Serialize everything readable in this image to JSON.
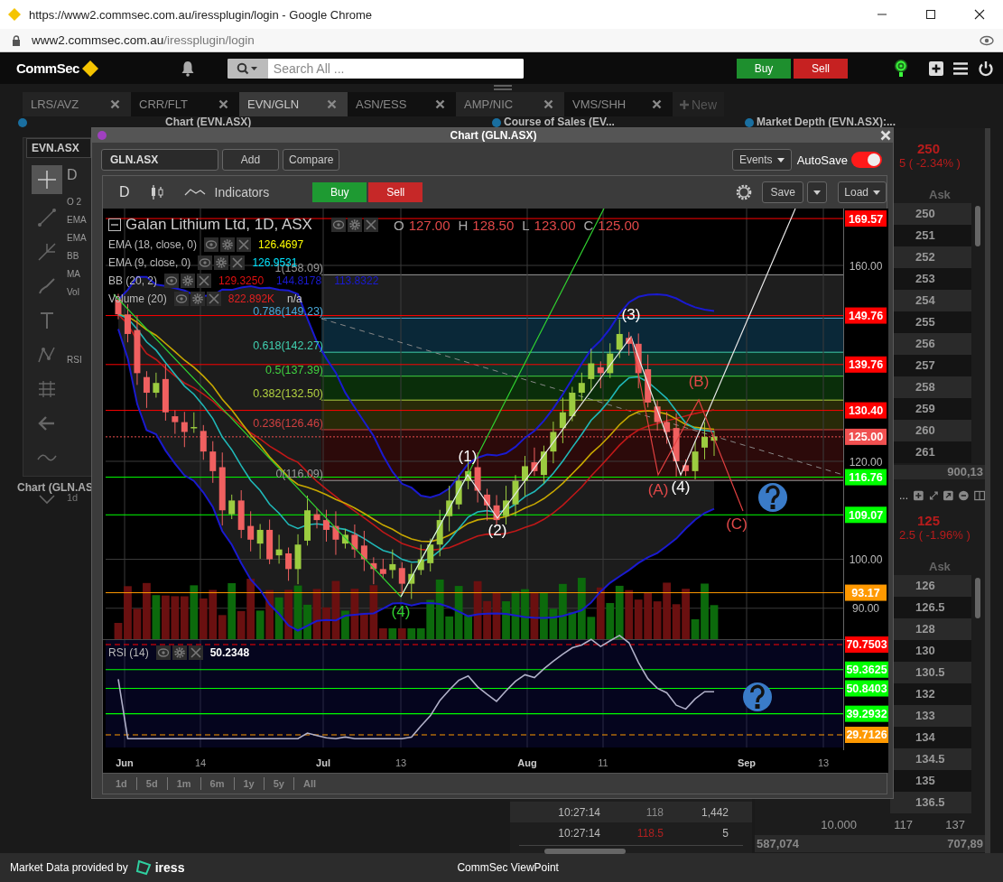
{
  "browser": {
    "title": "https://www2.commsec.com.au/iressplugin/login - Google Chrome",
    "url_host": "www2.commsec.com.au",
    "url_path": "/iressplugin/login"
  },
  "header": {
    "logo": "CommSec",
    "search_placeholder": "Search All ...",
    "buy": "Buy",
    "sell": "Sell"
  },
  "tabs": [
    {
      "label": "LRS/AVZ",
      "selected": false
    },
    {
      "label": "CRR/FLT",
      "selected": false
    },
    {
      "label": "EVN/GLN",
      "selected": true
    },
    {
      "label": "ASN/ESS",
      "selected": false
    },
    {
      "label": "AMP/NIC",
      "selected": false
    },
    {
      "label": "VMS/SHH",
      "selected": false
    }
  ],
  "new_tab": "New",
  "panel_titles": [
    "Chart (EVN.ASX)",
    "Course of Sales (EV...",
    "Market Depth (EVN.ASX):..."
  ],
  "background_chart": {
    "symbol": "EVN.ASX",
    "period": "D",
    "legend_fragments": [
      "O 2",
      "EMA",
      "EMA",
      "BB",
      "MA",
      "Vol",
      "RSI"
    ],
    "range": "1d",
    "tab": "Chart (GLN.AS"
  },
  "course_of_sales": [
    {
      "time": "10:27:14",
      "price": "118",
      "volume": "1,442",
      "color": "#8a8a8a"
    },
    {
      "time": "10:27:14",
      "price": "118.5",
      "volume": "5",
      "color": "#b02020"
    }
  ],
  "depth": [
    {
      "last": "250",
      "change": "5 ( -2.34% )",
      "ask_header": "Ask",
      "asks": [
        "250",
        "251",
        "252",
        "253",
        "254",
        "255",
        "256",
        "257",
        "258",
        "259",
        "260",
        "261"
      ],
      "total": "900,13"
    },
    {
      "title_end": "...",
      "last": "125",
      "change": "2.5 ( -1.96% )",
      "ask_header": "Ask",
      "asks": [
        "126",
        "126.5",
        "128",
        "130",
        "130.5",
        "132",
        "133",
        "134",
        "134.5",
        "135",
        "136.5"
      ],
      "last_row": [
        "10.000",
        "117",
        "137"
      ],
      "totals": [
        "587,074",
        "707,89"
      ]
    }
  ],
  "chart_window": {
    "title": "Chart (GLN.ASX)",
    "symbol": "GLN.ASX",
    "add": "Add",
    "compare": "Compare",
    "events": "Events",
    "autosave": {
      "label": "AutoSave",
      "on": true
    },
    "period": "D",
    "indicators": "Indicators",
    "buy": "Buy",
    "sell": "Sell",
    "save": "Save",
    "load": "Load",
    "legend": {
      "title": "Galan Lithium Ltd, 1D, ASX",
      "ohlc": [
        {
          "key": "O",
          "value": "127.00"
        },
        {
          "key": "H",
          "value": "128.50"
        },
        {
          "key": "L",
          "value": "123.00"
        },
        {
          "key": "C",
          "value": "125.00"
        }
      ],
      "studies": [
        {
          "name": "EMA (18, close, 0)",
          "values": [
            {
              "text": "126.4697",
              "color": "#ffff00"
            }
          ]
        },
        {
          "name": "EMA (9, close, 0)",
          "values": [
            {
              "text": "126.9531",
              "color": "#00e5ff"
            }
          ]
        },
        {
          "name": "BB (20, 2)",
          "values": [
            {
              "text": "129.3250",
              "color": "#e01010"
            },
            {
              "text": "144.8178",
              "color": "#1a1ad0"
            },
            {
              "text": "113.8322",
              "color": "#1a1ad0"
            }
          ]
        },
        {
          "name": "Volume (20)",
          "values": [
            {
              "text": "822.892K",
              "color": "#e02020"
            },
            {
              "text": "n/a",
              "color": "#cccccc"
            }
          ]
        }
      ]
    },
    "fib_levels": [
      {
        "label": "1(158.09)",
        "color": "#9a9a9a"
      },
      {
        "label": "0.786(149.23)",
        "color": "#4aa8d8"
      },
      {
        "label": "0.618(142.27)",
        "color": "#40d0b0"
      },
      {
        "label": "0.5(137.39)",
        "color": "#40d040"
      },
      {
        "label": "0.382(132.50)",
        "color": "#b0d040"
      },
      {
        "label": "0.236(126.46)",
        "color": "#d04040"
      },
      {
        "label": "0(116.09)",
        "color": "#9a9a9a"
      }
    ],
    "wave_labels": [
      {
        "label": "(1)",
        "color": "#ffffff"
      },
      {
        "label": "(2)",
        "color": "#ffffff"
      },
      {
        "label": "(3)",
        "color": "#ffffff"
      },
      {
        "label": "(4)",
        "color": "#ffffff"
      },
      {
        "label": "(4)",
        "color": "#30d030"
      },
      {
        "label": "(A)",
        "color": "#e04848"
      },
      {
        "label": "(B)",
        "color": "#e04848"
      },
      {
        "label": "(C)",
        "color": "#e04848"
      }
    ],
    "price_axis": [
      {
        "label": "169.57",
        "kind": "tag",
        "color": "#ff0000"
      },
      {
        "label": "160.00",
        "kind": "tick"
      },
      {
        "label": "149.76",
        "kind": "tag",
        "color": "#ff0000"
      },
      {
        "label": "139.76",
        "kind": "tag",
        "color": "#ff0000"
      },
      {
        "label": "130.40",
        "kind": "tag",
        "color": "#ff0000"
      },
      {
        "label": "125.00",
        "kind": "tag",
        "color": "#f05050"
      },
      {
        "label": "120.00",
        "kind": "tick"
      },
      {
        "label": "116.76",
        "kind": "tag",
        "color": "#00ff00"
      },
      {
        "label": "109.07",
        "kind": "tag",
        "color": "#00ff00"
      },
      {
        "label": "100.00",
        "kind": "tick"
      },
      {
        "label": "93.17",
        "kind": "tag",
        "color": "#ff9900"
      },
      {
        "label": "90.00",
        "kind": "tick"
      }
    ],
    "rsi": {
      "name": "RSI (14)",
      "value": "50.2348",
      "axis": [
        {
          "label": "70.7503",
          "kind": "bound",
          "color": "#ff0000"
        },
        {
          "label": "59.3625",
          "kind": "level",
          "color": "#00ff00"
        },
        {
          "label": "50.8403",
          "kind": "level",
          "color": "#00ff00"
        },
        {
          "label": "39.2932",
          "kind": "level",
          "color": "#00ff00"
        },
        {
          "label": "29.7126",
          "kind": "bound",
          "color": "#ff9900"
        }
      ]
    },
    "dates": [
      {
        "label": "Jun",
        "kind": "month"
      },
      {
        "label": "14",
        "kind": "day"
      },
      {
        "label": "Jul",
        "kind": "month"
      },
      {
        "label": "13",
        "kind": "day"
      },
      {
        "label": "Aug",
        "kind": "month"
      },
      {
        "label": "11",
        "kind": "day"
      },
      {
        "label": "Sep",
        "kind": "month"
      },
      {
        "label": "13",
        "kind": "day"
      }
    ],
    "ranges": [
      "1d",
      "5d",
      "1m",
      "6m",
      "1y",
      "5y",
      "All"
    ]
  },
  "footer": {
    "provider": "Market Data provided by",
    "provider_logo": "iress",
    "title": "CommSec ViewPoint"
  }
}
